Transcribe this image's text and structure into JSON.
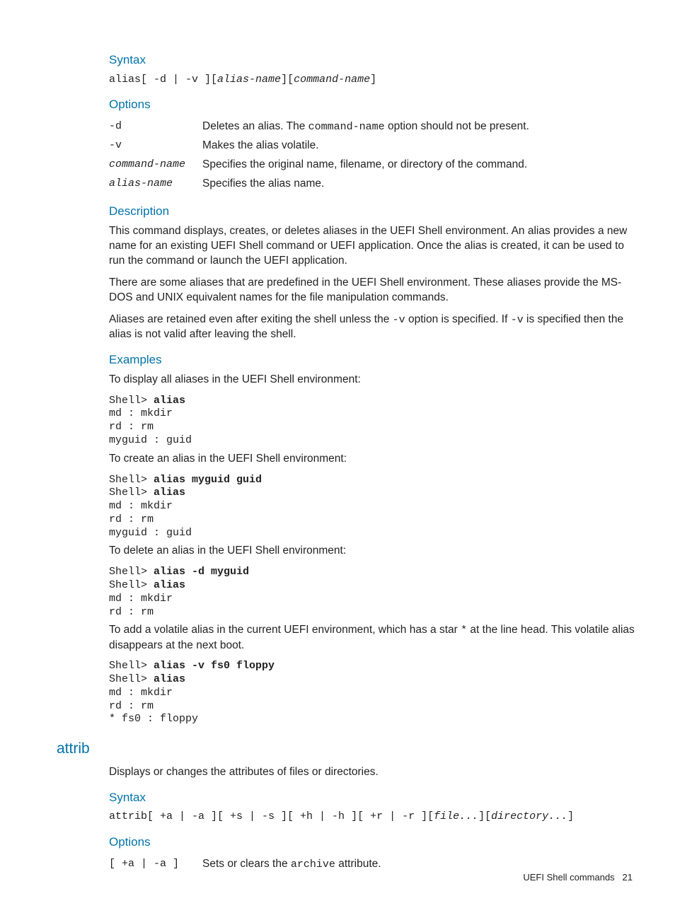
{
  "s1": {
    "syntax_h": "Syntax",
    "syntax_cmd": "alias",
    "syntax_flags": "[ -d | -v ][",
    "syntax_a1": "alias-name",
    "syntax_mid1": "][",
    "syntax_a2": "command-name",
    "syntax_end": "]",
    "options_h": "Options",
    "opt_d_term": "-d",
    "opt_d_desc_a": "Deletes an alias. The ",
    "opt_d_desc_code": "command-name",
    "opt_d_desc_b": " option should not be present.",
    "opt_v_term": "-v",
    "opt_v_desc": "Makes the alias volatile.",
    "opt_cmd_term": "command-name",
    "opt_cmd_desc": "Specifies the original name, filename, or directory of the command.",
    "opt_alias_term": "alias-name",
    "opt_alias_desc": "Specifies the alias name.",
    "desc_h": "Description",
    "desc_p1": "This command displays, creates, or deletes aliases in the UEFI Shell environment. An alias provides a new name for an existing UEFI Shell command or UEFI application. Once the alias is created, it can be used to run the command or launch the UEFI application.",
    "desc_p2": "There are some aliases that are predefined in the UEFI Shell environment. These aliases provide the MS-DOS and UNIX equivalent names for the file manipulation commands.",
    "desc_p3a": "Aliases are retained even after exiting the shell unless the ",
    "desc_p3_code1": "-v",
    "desc_p3b": " option is specified. If ",
    "desc_p3_code2": "-v",
    "desc_p3c": " is specified then the alias is not valid after leaving the shell.",
    "ex_h": "Examples",
    "ex1_intro": "To display all aliases in the UEFI Shell environment:",
    "ex1_l1a": "Shell> ",
    "ex1_l1b": "alias",
    "ex1_l2": "md : mkdir",
    "ex1_l3": "rd : rm",
    "ex1_l4": "myguid : guid",
    "ex2_intro": "To create an alias in the UEFI Shell environment:",
    "ex2_l1a": "Shell> ",
    "ex2_l1b": "alias myguid guid",
    "ex2_l2a": "Shell> ",
    "ex2_l2b": "alias",
    "ex2_l3": "md : mkdir",
    "ex2_l4": "rd : rm",
    "ex2_l5": "myguid : guid",
    "ex3_intro": "To delete an alias in the UEFI Shell environment:",
    "ex3_l1a": "Shell> ",
    "ex3_l1b": "alias -d myguid",
    "ex3_l2a": "Shell> ",
    "ex3_l2b": "alias",
    "ex3_l3": "md : mkdir",
    "ex3_l4": "rd : rm",
    "ex4_intro_a": "To add a volatile alias in the current UEFI environment, which has a star ",
    "ex4_star": "*",
    "ex4_intro_b": " at the line head. This volatile alias disappears at the next boot.",
    "ex4_l1a": "Shell> ",
    "ex4_l1b": "alias -v fs0 floppy",
    "ex4_l2a": "Shell> ",
    "ex4_l2b": "alias",
    "ex4_l3": "md : mkdir",
    "ex4_l4": "rd : rm",
    "ex4_l5": "* fs0 : floppy"
  },
  "s2": {
    "title": "attrib",
    "intro": "Displays or changes the attributes of files or directories.",
    "syntax_h": "Syntax",
    "syntax_cmd": "attrib",
    "syntax_flags": "[ +a | -a ][ +s | -s ][ +h | -h ][ +r | -r ][",
    "syntax_a1": "file...",
    "syntax_mid": "][",
    "syntax_a2": "directory...",
    "syntax_end": "]",
    "options_h": "Options",
    "opt_a_term": "[ +a | -a ]",
    "opt_a_desc_a": "Sets or clears the ",
    "opt_a_desc_code": "archive",
    "opt_a_desc_b": " attribute."
  },
  "footer": {
    "label": "UEFI Shell commands",
    "page": "21"
  }
}
